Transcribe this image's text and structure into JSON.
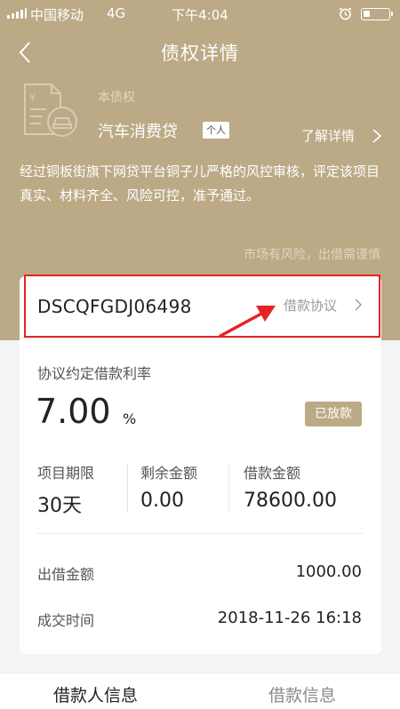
{
  "status_bar": {
    "carrier": "中国移动",
    "network": "4G",
    "time": "下午4:04",
    "icons": [
      "signal-icon",
      "alarm-icon",
      "battery-icon"
    ]
  },
  "nav": {
    "title": "债权详情",
    "back_icon": "chevron-left-icon"
  },
  "product": {
    "icon": "loan-document-icon",
    "sub_label": "本债权",
    "name": "汽车消费贷",
    "badge": "个人",
    "learn_more": "了解详情",
    "description": "经过铜板街旗下网贷平台铜子儿严格的风控审核，评定该项目真实、材料齐全、风险可控，准予通过。",
    "risk_notice": "市场有风险，出借需谨慎"
  },
  "card": {
    "code": "DSCQFGDJ06498",
    "agreement_link": "借款协议",
    "rate_label": "协议约定借款利率",
    "rate_value": "7.00",
    "rate_unit": "%",
    "status_badge": "已放款",
    "stats": [
      {
        "label": "项目期限",
        "value": "30天"
      },
      {
        "label": "剩余金额",
        "value": "0.00"
      },
      {
        "label": "借款金额",
        "value": "78600.00"
      }
    ],
    "rows": [
      {
        "label": "出借金额",
        "value": "1000.00"
      },
      {
        "label": "成交时间",
        "value": "2018-11-26 16:18"
      }
    ]
  },
  "tabs": [
    {
      "label": "借款人信息",
      "active": true
    },
    {
      "label": "借款信息",
      "active": false
    }
  ],
  "colors": {
    "brand_gold": "#bca986",
    "annotation_red": "#e52424",
    "background": "#f4f4f4"
  }
}
